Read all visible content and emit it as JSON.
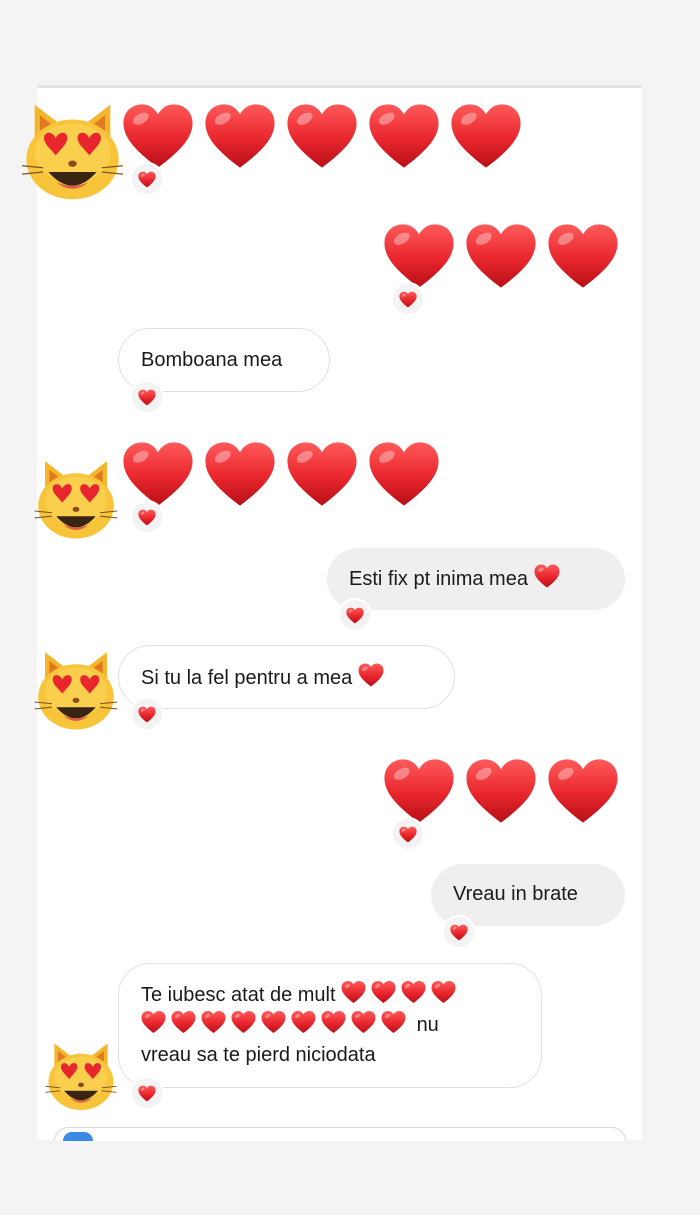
{
  "conversation": {
    "messages": [
      {
        "direction": "incoming",
        "kind": "emoji",
        "content": "❤️❤️❤️❤️❤️",
        "reaction": "❤️"
      },
      {
        "direction": "outgoing",
        "kind": "emoji",
        "content": "❤️❤️❤️",
        "reaction": "❤️"
      },
      {
        "direction": "incoming",
        "kind": "text",
        "text": "Bomboana mea",
        "reaction": "❤️"
      },
      {
        "direction": "incoming",
        "kind": "emoji",
        "content": "❤️❤️❤️❤️",
        "reaction": "❤️"
      },
      {
        "direction": "outgoing",
        "kind": "text",
        "text": "Esti fix pt inima mea",
        "trailing_emoji": "❤️",
        "reaction": "❤️"
      },
      {
        "direction": "incoming",
        "kind": "text",
        "text": "Si tu la fel pentru a mea",
        "trailing_emoji": "❤️",
        "reaction": "❤️"
      },
      {
        "direction": "outgoing",
        "kind": "emoji",
        "content": "❤️❤️❤️",
        "reaction": "❤️"
      },
      {
        "direction": "outgoing",
        "kind": "text",
        "text": "Vreau in brate",
        "reaction": "❤️"
      },
      {
        "direction": "incoming",
        "kind": "text",
        "text_start": "Te iubesc atat de mult",
        "hearts": "❤️❤️❤️❤️❤️❤️❤️❤️❤️❤️❤️❤️❤️",
        "text_mid": "nu",
        "text_end": "vreau sa te pierd niciodata",
        "reaction": "❤️"
      }
    ]
  },
  "avatar": {
    "icon": "heart-eyes-cat-icon"
  },
  "colors": {
    "heart": "#e8262d",
    "incoming_bubble_border": "#e2e2e2",
    "outgoing_bubble": "#efefef",
    "composer_camera": "#3b8ae5"
  }
}
